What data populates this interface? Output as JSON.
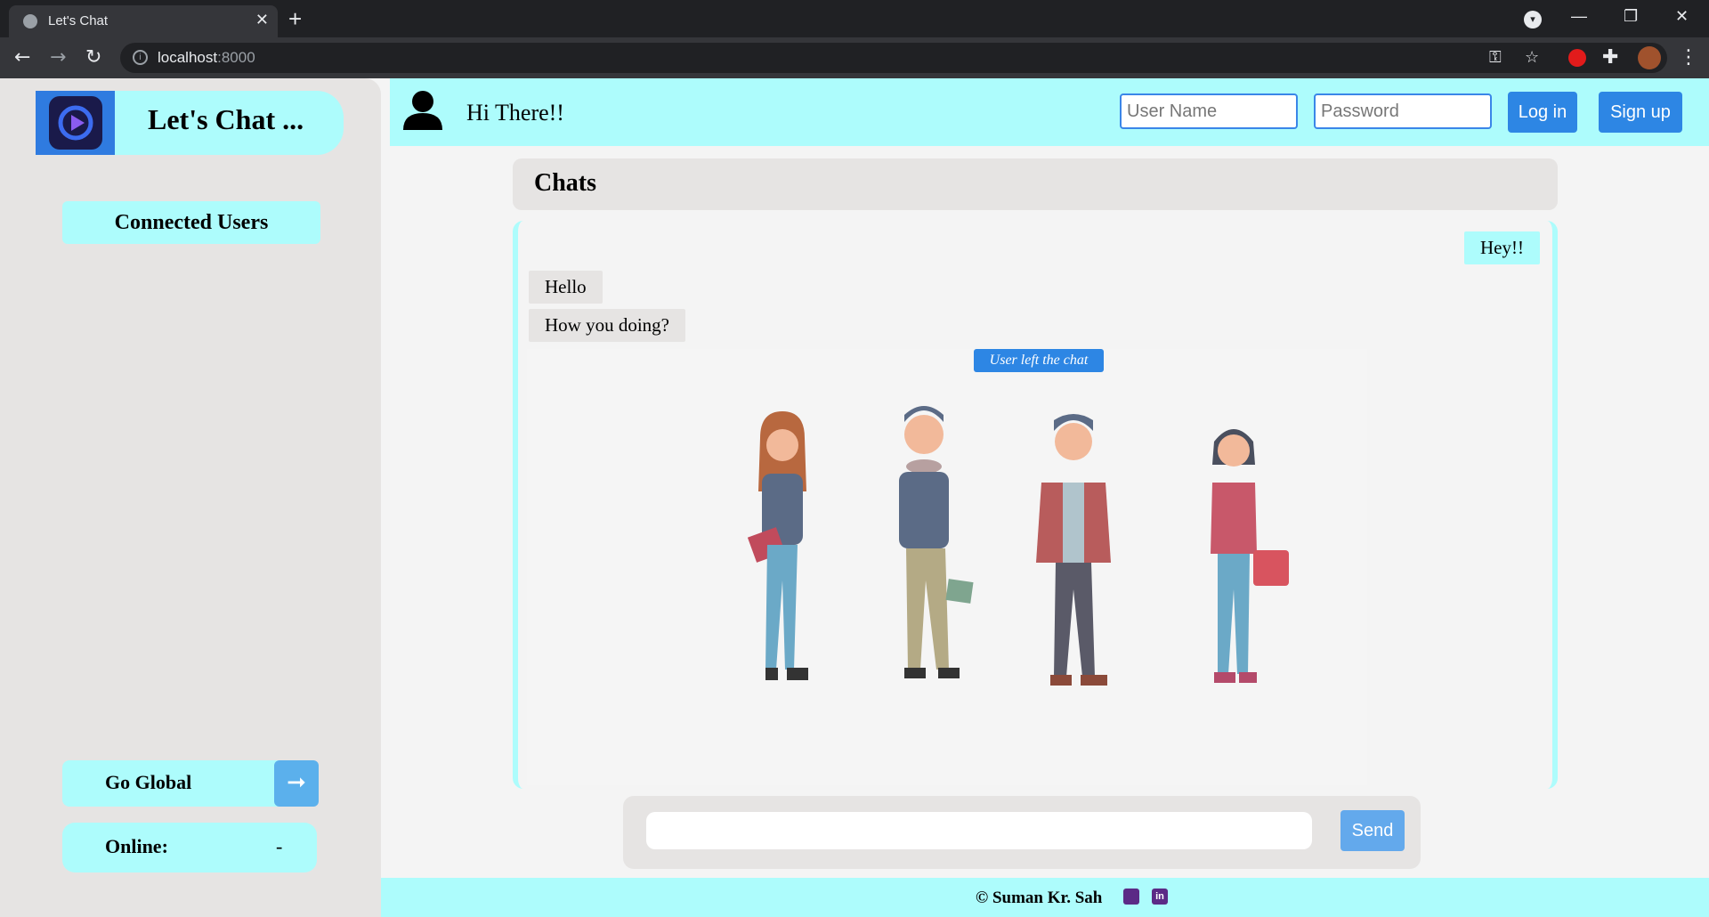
{
  "browser": {
    "tab_title": "Let's Chat",
    "new_tab": "+",
    "tab_close": "✕",
    "url_host": "localhost",
    "url_port": ":8000",
    "minimize": "—",
    "maximize": "❐",
    "close": "✕"
  },
  "app": {
    "brand_name": "Let's Chat ...",
    "connected_users_label": "Connected Users",
    "go_global_label": "Go Global",
    "go_global_arrow": "➞",
    "online_label": "Online:",
    "online_value": "-"
  },
  "header": {
    "greeting": "Hi There!!",
    "username_placeholder": "User Name",
    "password_placeholder": "Password",
    "login_label": "Log in",
    "signup_label": "Sign up"
  },
  "chat": {
    "title": "Chats",
    "messages": [
      {
        "direction": "outgoing",
        "text": "Hey!!"
      },
      {
        "direction": "incoming",
        "text": "Hello"
      },
      {
        "direction": "incoming",
        "text": "How you doing?"
      }
    ],
    "system_note": "User left the chat"
  },
  "composer": {
    "send_label": "Send"
  },
  "footer": {
    "copyright": "© Suman Kr. Sah",
    "linkedin_glyph": "in"
  },
  "colors": {
    "accent_cyan": "#adfcfc",
    "primary_blue": "#2d86e4",
    "panel_gray": "#e6e4e3"
  }
}
